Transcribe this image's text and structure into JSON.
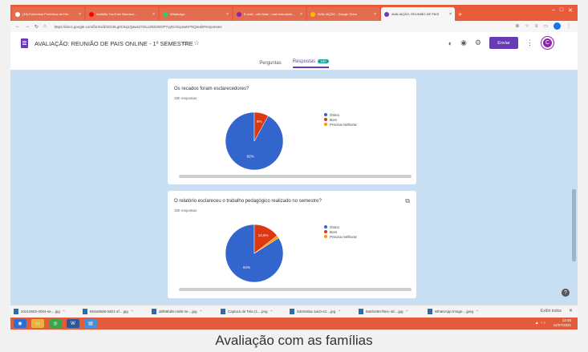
{
  "browser": {
    "tabs": [
      {
        "label": "(19) Entrevista Prefeitura de Her...",
        "color": "#ffffff",
        "active": false
      },
      {
        "label": "Aultidão YouTube Banrisul...",
        "color": "#ff0000",
        "active": false
      },
      {
        "label": "WhatsApp",
        "color": "#25d366",
        "active": false
      },
      {
        "label": "E-mail - não lidas - mail.estudante...",
        "color": "#8e24aa",
        "active": false
      },
      {
        "label": "AVALIAÇÃO - Google Drive",
        "color": "#fbbc04",
        "active": false
      },
      {
        "label": "AVALIAÇÃO: REUNIÃO DE PAIS",
        "color": "#673ab7",
        "active": true
      }
    ],
    "new_tab": "+",
    "url": "https://docs.google.com/forms/d/1Dz0Lg0C6q1Qaws27sILcZ6DzBOPYyjOcOcpswKFNQ/edit#responses"
  },
  "form": {
    "title": "AVALIAÇÃO: REUNIÃO DE PAIS ONLINE - 1º SEMESTRE",
    "send_label": "Enviar",
    "avatar_letter": "C",
    "tabs": {
      "questions": "Perguntas",
      "responses": "Respostas",
      "responses_count": "180"
    }
  },
  "cards": [
    {
      "question": "Os recados foram esclarecedores?",
      "responses": "180 respostas",
      "chart_data": {
        "type": "pie",
        "labels": [
          "Ótimo",
          "Bom",
          "Precisa melhorar"
        ],
        "values": [
          92,
          8,
          0
        ],
        "slice_labels": [
          "92%",
          "8%",
          ""
        ],
        "colors": [
          "#3366cc",
          "#dc3912",
          "#ff9900"
        ]
      }
    },
    {
      "question": "O relatório esclareceu o trabalho pedagógico realizado no semestre?",
      "responses": "180 respostas",
      "chart_data": {
        "type": "pie",
        "labels": [
          "Ótimo",
          "Bom",
          "Precisa melhorar"
        ],
        "values": [
          84,
          14.5,
          1.5
        ],
        "slice_labels": [
          "84%",
          "14,5%",
          ""
        ],
        "colors": [
          "#3366cc",
          "#dc3912",
          "#ff9900"
        ]
      }
    }
  ],
  "downloads": [
    "20210602-0004-se....jpg",
    "8848d8d8-0d01-4f....jpg",
    "d6f68bd8-c6d9-4e....jpg",
    "Captura de Tela (1....png",
    "0dc9c5ba-1ac0-41....jpg",
    "8a6f4460-f6e1-4d....jpg",
    "WhatsApp Image....jpeg"
  ],
  "show_all": "Exibir todos",
  "clock": {
    "time": "13:45",
    "date": "11/07/2021"
  },
  "caption": "Avaliação com as famílias"
}
